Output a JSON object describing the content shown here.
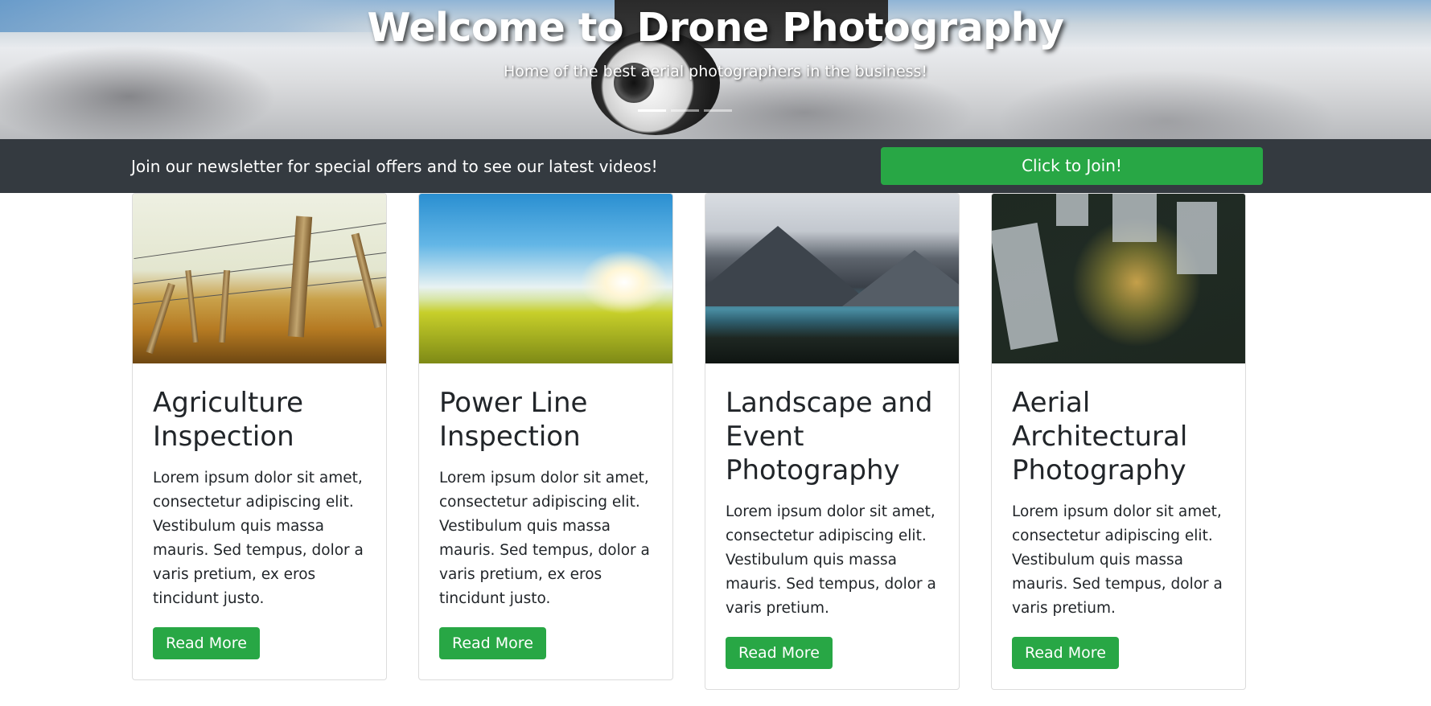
{
  "hero": {
    "title": "Welcome to Drone Photography",
    "subtitle": "Home of the best aerial photographers in the business!",
    "slides": 3,
    "active_slide": 1
  },
  "newsletter": {
    "text": "Join our newsletter for special offers and to see our latest videos!",
    "button_label": "Click to Join!"
  },
  "cards": [
    {
      "title": "Agriculture Inspection",
      "text": "Lorem ipsum dolor sit amet, consectetur adipiscing elit. Vestibulum quis massa mauris. Sed tempus, dolor a varis pretium, ex eros tincidunt justo.",
      "button_label": "Read More"
    },
    {
      "title": "Power Line Inspection",
      "text": "Lorem ipsum dolor sit amet, consectetur adipiscing elit. Vestibulum quis massa mauris. Sed tempus, dolor a varis pretium, ex eros tincidunt justo.",
      "button_label": "Read More"
    },
    {
      "title": "Landscape and Event Photography",
      "text": "Lorem ipsum dolor sit amet, consectetur adipiscing elit. Vestibulum quis massa mauris. Sed tempus, dolor a varis pretium.",
      "button_label": "Read More"
    },
    {
      "title": "Aerial Architectural Photography",
      "text": "Lorem ipsum dolor sit amet, consectetur adipiscing elit. Vestibulum quis massa mauris. Sed tempus, dolor a varis pretium.",
      "button_label": "Read More"
    }
  ],
  "colors": {
    "accent_green": "#28a745",
    "dark_bar": "#343a40"
  }
}
